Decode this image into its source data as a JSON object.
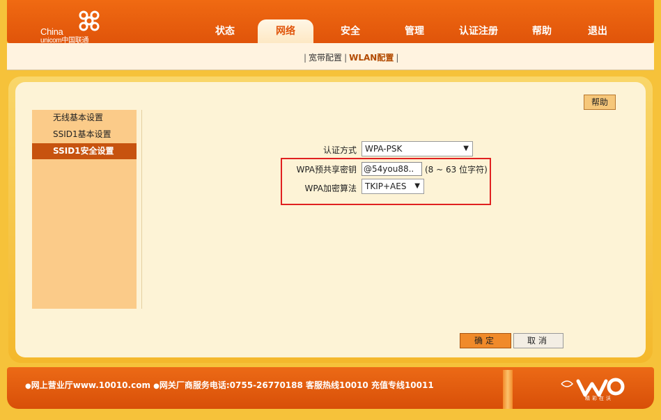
{
  "brand": {
    "name_line1": "China",
    "name_line2": "unicom中国联通"
  },
  "nav": {
    "items": [
      {
        "label": "状态"
      },
      {
        "label": "网络"
      },
      {
        "label": "安全"
      },
      {
        "label": "管理"
      },
      {
        "label": "认证注册"
      },
      {
        "label": "帮助"
      },
      {
        "label": "退出"
      }
    ],
    "active": "网络"
  },
  "subnav": {
    "separator": "|",
    "items": [
      {
        "label": "宽带配置"
      },
      {
        "label": "WLAN配置"
      }
    ],
    "active": "WLAN配置"
  },
  "help_button": "帮助",
  "sidebar": {
    "items": [
      {
        "label": "无线基本设置"
      },
      {
        "label": "SSID1基本设置"
      },
      {
        "label": "SSID1安全设置"
      }
    ],
    "active": "SSID1安全设置"
  },
  "form": {
    "auth_label": "认证方式",
    "auth_value": "WPA-PSK",
    "psk_label": "WPA预共享密钥",
    "psk_value": "@54you88..",
    "psk_hint": "(8 ~ 63 位字符)",
    "cipher_label": "WPA加密算法",
    "cipher_value": "TKIP+AES"
  },
  "buttons": {
    "ok": "确定",
    "cancel": "取消"
  },
  "footer": {
    "text1": "网上营业厅www.10010.com",
    "text2": "网关厂商服务电话:0755-26770188 客服热线10010 充值专线10011",
    "logo_tagline": "精彩在沃"
  },
  "colors": {
    "brand_orange": "#e0540a",
    "highlight_red": "#e02020",
    "sidebar_active": "#c7530f"
  }
}
